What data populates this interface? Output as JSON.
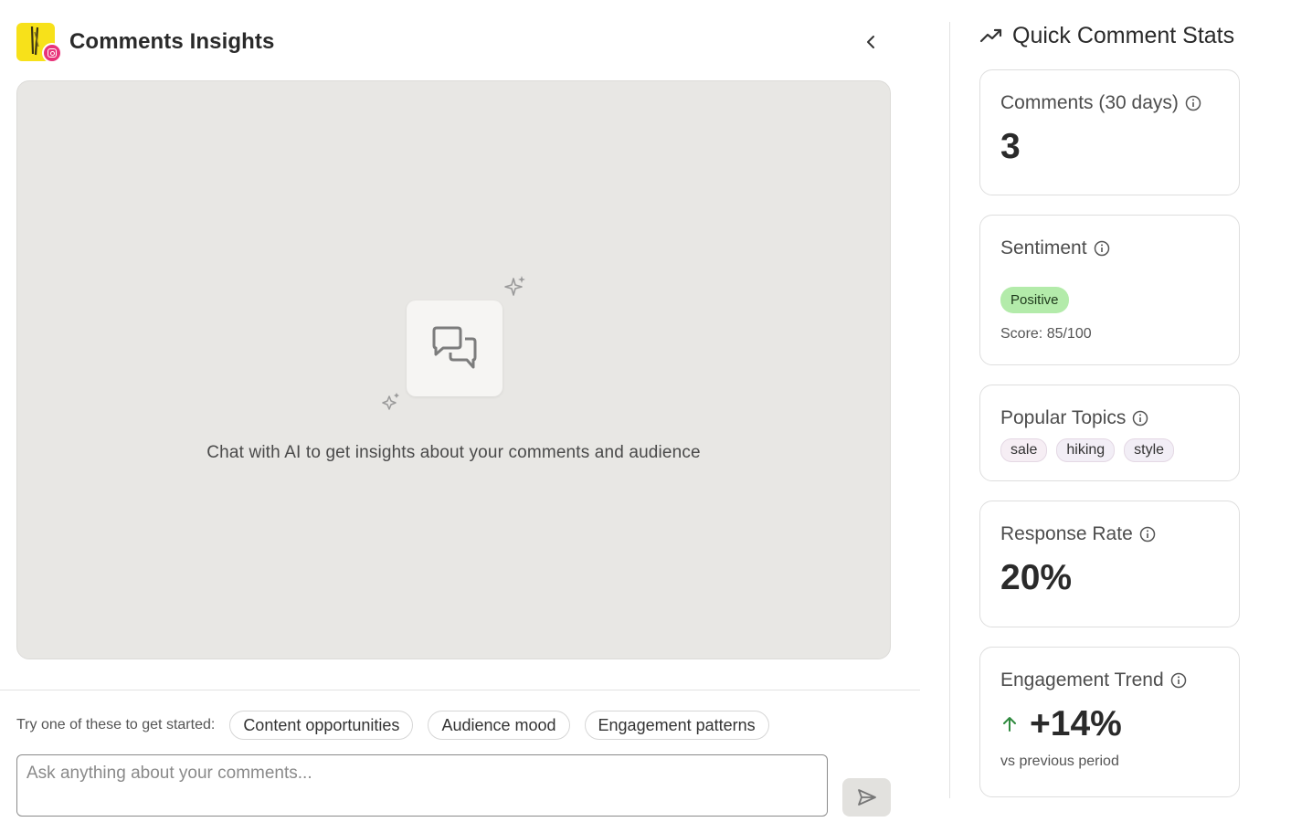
{
  "header": {
    "title": "Comments Insights",
    "collapse_icon": "chevron-left-icon"
  },
  "chat": {
    "empty_icon": "chat-bubbles-icon",
    "empty_text": "Chat with AI to get insights about your comments and audience"
  },
  "suggestions": {
    "label": "Try one of these to get started:",
    "chips": [
      "Content opportunities",
      "Audience mood",
      "Engagement patterns"
    ]
  },
  "input": {
    "placeholder": "Ask anything about your comments...",
    "value": ""
  },
  "stats": {
    "title": "Quick Comment Stats",
    "title_icon": "trending-up-icon",
    "comments": {
      "label": "Comments (30 days)",
      "value": "3"
    },
    "sentiment": {
      "label": "Sentiment",
      "badge": "Positive",
      "score": "Score: 85/100",
      "badge_color": "#b3ebaa"
    },
    "topics": {
      "label": "Popular Topics",
      "items": [
        "sale",
        "hiking",
        "style"
      ]
    },
    "response_rate": {
      "label": "Response Rate",
      "value": "20%"
    },
    "engagement": {
      "label": "Engagement Trend",
      "value": "+14%",
      "sub": "vs previous period",
      "arrow_color": "#2f8a3e"
    }
  },
  "colors": {
    "brand_yellow": "#f7e11a",
    "instagram_pink": "#e8347a",
    "chat_bg": "#e8e7e4"
  }
}
